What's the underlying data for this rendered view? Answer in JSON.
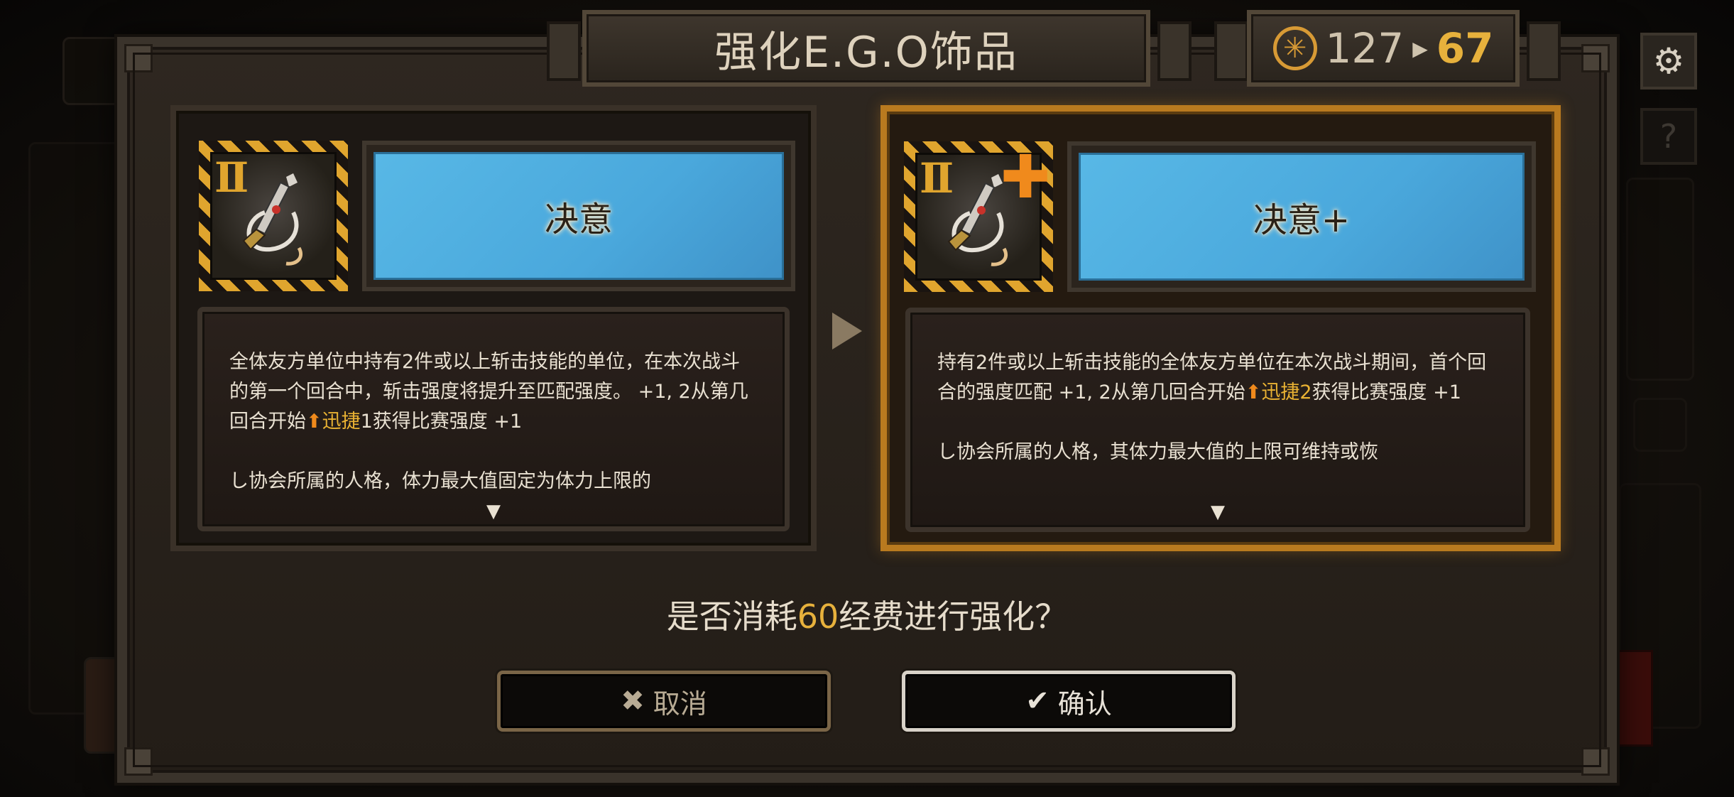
{
  "title": "强化E.G.O饰品",
  "cost": {
    "icon": "coin-asterisk-icon",
    "current": "127",
    "after": "67"
  },
  "side_buttons": [
    {
      "icon": "gear-icon"
    },
    {
      "icon": "question-icon"
    }
  ],
  "before": {
    "grade": "II",
    "name": "决意",
    "description": [
      {
        "t": "全体友方单位中持有2件或以上斩击技能的单位，在本次战斗的第一个回合中，斩击强度将提升至匹配强度。 +1, 2从第几回合开始",
        "s": "normal"
      },
      {
        "t": "⬆",
        "s": "up"
      },
      {
        "t": "迅捷",
        "s": "kw"
      },
      {
        "t": "1获得比赛强度 +1",
        "s": "normal"
      }
    ],
    "description_more": "し协会所属的人格，体力最大值固定为体力上限的",
    "scroll_indicator": "▼"
  },
  "after": {
    "grade": "II",
    "upgrade_mark": "✚",
    "name": "决意+",
    "description": [
      {
        "t": "持有2件或以上斩击技能的全体友方单位在本次战斗期间，首个回合的强度匹配 +1, 2从第几回合开始",
        "s": "normal"
      },
      {
        "t": "⬆",
        "s": "up"
      },
      {
        "t": "迅捷",
        "s": "kw"
      },
      {
        "t": "2",
        "s": "kw"
      },
      {
        "t": "获得比赛强度 +1",
        "s": "normal"
      }
    ],
    "description_more": "し协会所属的人格，其体力最大值的上限可维持或恢",
    "scroll_indicator": "▼"
  },
  "question": {
    "prefix": "是否消耗",
    "cost": "60",
    "suffix": "经费进行强化？"
  },
  "buttons": {
    "cancel": {
      "icon": "✖",
      "label": "取消"
    },
    "confirm": {
      "icon": "✔",
      "label": "确认"
    }
  },
  "colors": {
    "accent_gold": "#e7b13c",
    "name_banner_blue": "#4aa8dc",
    "highlight_border": "#b97a1f"
  }
}
